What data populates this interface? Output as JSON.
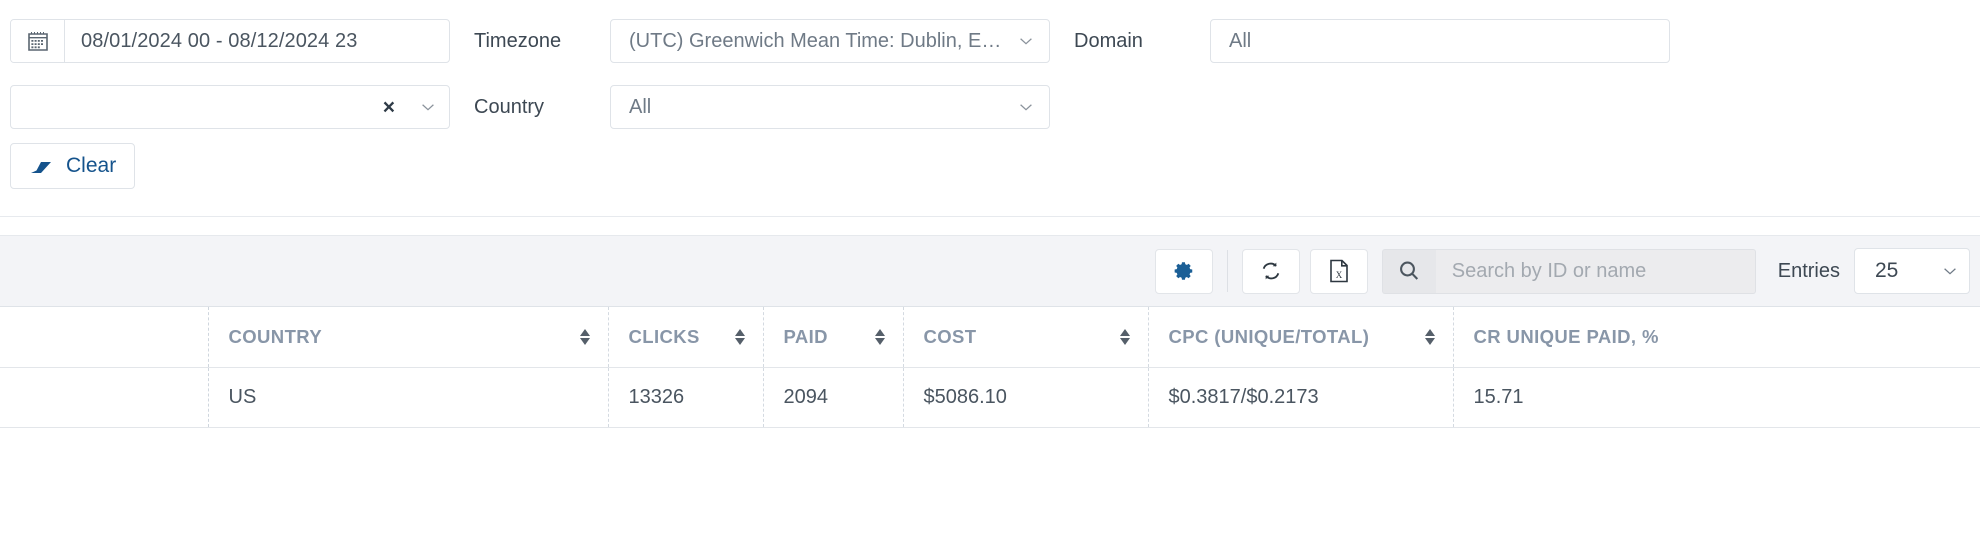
{
  "filters": {
    "date_range": {
      "icon": "calendar-icon",
      "value": "08/01/2024 00 - 08/12/2024 23"
    },
    "country_select_top": {
      "value": "",
      "clear_glyph": "×",
      "icon": "chevron-down-icon"
    },
    "timezone": {
      "label": "Timezone",
      "value": "(UTC) Greenwich Mean Time: Dublin, Edinbur...",
      "icon": "chevron-down-icon"
    },
    "country": {
      "label": "Country",
      "value": "All",
      "icon": "chevron-down-icon"
    },
    "domain": {
      "label": "Domain",
      "value": "All",
      "icon": "chevron-down-icon"
    },
    "clear_button": {
      "label": "Clear",
      "icon": "eraser-icon",
      "color": "#15538c"
    }
  },
  "toolbar": {
    "settings_icon": "gear-icon",
    "refresh_icon": "refresh-icon",
    "export_icon": "excel-file-icon",
    "search": {
      "icon": "search-icon",
      "placeholder": "Search by ID or name",
      "value": ""
    },
    "entries": {
      "label": "Entries",
      "value": "25",
      "icon": "chevron-down-icon"
    }
  },
  "table": {
    "columns": [
      {
        "label": "",
        "sortable": false
      },
      {
        "label": "COUNTRY",
        "sortable": true
      },
      {
        "label": "CLICKS",
        "sortable": true
      },
      {
        "label": "PAID",
        "sortable": true
      },
      {
        "label": "COST",
        "sortable": true
      },
      {
        "label": "CPC (UNIQUE/TOTAL)",
        "sortable": true
      },
      {
        "label": "CR UNIQUE PAID, %",
        "sortable": false
      }
    ],
    "rows": [
      {
        "blank": "",
        "country": "US",
        "clicks": "13326",
        "paid": "2094",
        "cost": "$5086.10",
        "cpc": "$0.3817/$0.2173",
        "cr_unique_paid": "15.71"
      }
    ]
  },
  "colors": {
    "accent_blue": "#15538c",
    "gear_blue": "#1b5f96",
    "header_text": "#8896a8",
    "toolbar_bg": "#f3f4f7",
    "border": "#dfe3e8"
  }
}
